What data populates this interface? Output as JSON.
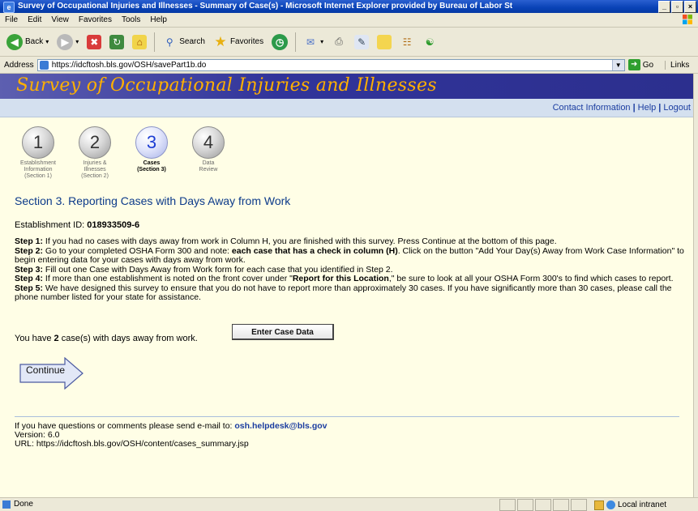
{
  "window": {
    "title": "Survey of Occupational Injuries and Illnesses - Summary of Case(s) - Microsoft Internet Explorer provided by Bureau of Labor St",
    "controls": [
      "_",
      "▫",
      "×"
    ]
  },
  "menu": [
    "File",
    "Edit",
    "View",
    "Favorites",
    "Tools",
    "Help"
  ],
  "toolbar": {
    "back": "Back",
    "search": "Search",
    "favorites": "Favorites"
  },
  "address": {
    "label": "Address",
    "url": "https://idcftosh.bls.gov/OSH/savePart1b.do",
    "go": "Go",
    "links": "Links"
  },
  "page": {
    "banner_title": "Survey of Occupational Injuries and Illnesses",
    "top_links": [
      "Contact Information",
      "Help",
      "Logout"
    ],
    "steps": [
      {
        "number": "1",
        "label_line1": "Establishment",
        "label_line2": "Information",
        "label_line3": "(Section 1)"
      },
      {
        "number": "2",
        "label_line1": "Injuries &",
        "label_line2": "Illnesses",
        "label_line3": "(Section 2)"
      },
      {
        "number": "3",
        "label_line1": "Cases",
        "label_line2": "(Section 3)",
        "label_line3": ""
      },
      {
        "number": "4",
        "label_line1": "Data",
        "label_line2": "Review",
        "label_line3": ""
      }
    ],
    "active_step": 3,
    "section_title": "Section 3. Reporting Cases with Days Away from Work",
    "establishment_label": "Establishment ID:",
    "establishment_id": "018933509-6",
    "step_lines": [
      {
        "label": "Step 1:",
        "text": " If you had no cases with days away from work in Column H, you are finished with this survey. Press Continue at the bottom of this page."
      },
      {
        "label": "Step 2:",
        "text_before": " Go to your completed OSHA Form 300 and note: ",
        "bold": "each case that has a check in column (H)",
        "text_after": ". Click on the button \"Add Your Day(s) Away from Work Case Information\" to begin entering data for your cases with days away from work."
      },
      {
        "label": "Step 3:",
        "text": " Fill out one Case with Days Away from Work form for each case that you identified in Step 2."
      },
      {
        "label": "Step 4:",
        "text_before": " If more than one establishment is noted on the front cover under \"",
        "bold": "Report for this Location",
        "text_after": ",\" be sure to look at all your OSHA Form 300's to find which cases to report."
      },
      {
        "label": "Step 5:",
        "text": " We have designed this survey to ensure that you do not have to report more than approximately 30 cases. If you have significantly more than 30 cases, please call the phone number listed for your state for assistance."
      }
    ],
    "cases_prefix": "You have ",
    "cases_count": "2",
    "cases_suffix": " case(s) with days away from work.",
    "enter_button": "Enter Case Data",
    "continue_button": "Continue",
    "footer_prefix": "If you have questions or comments please send e-mail to: ",
    "footer_email": "osh.helpdesk@bls.gov",
    "version": "Version: 6.0",
    "footer_url": "URL: https://idcftosh.bls.gov/OSH/content/cases_summary.jsp"
  },
  "status": {
    "text": "Done",
    "zone": "Local intranet"
  }
}
